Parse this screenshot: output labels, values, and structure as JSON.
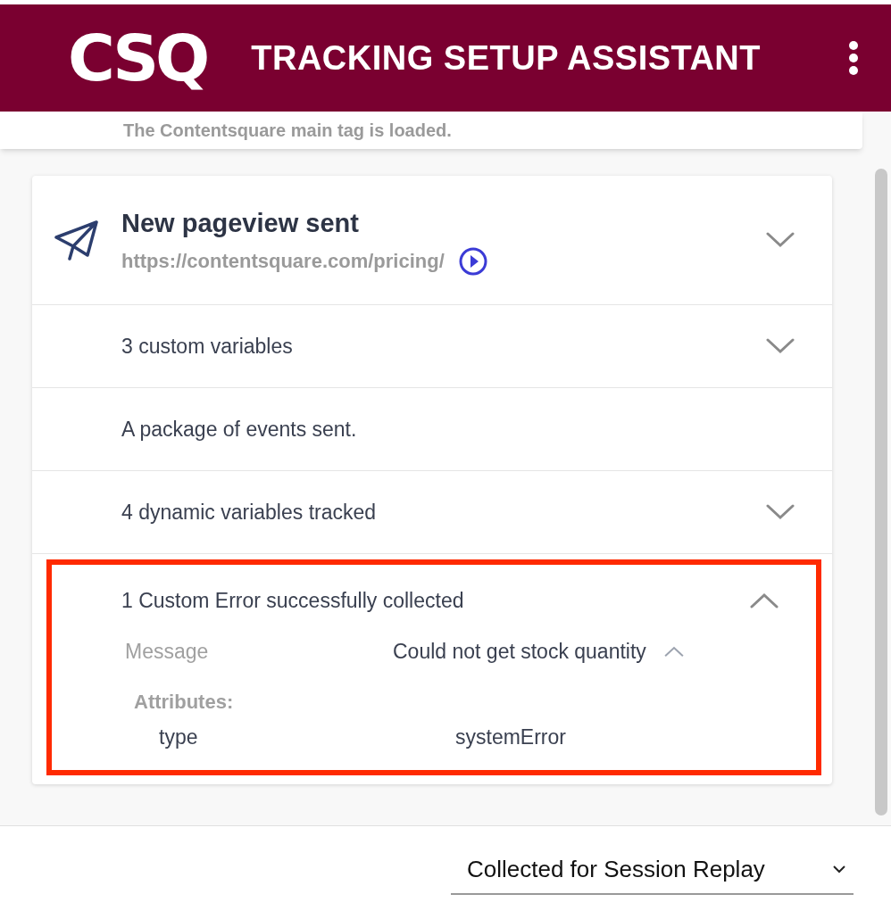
{
  "header": {
    "logo": "CSQ",
    "title": "TRACKING SETUP ASSISTANT"
  },
  "status_card": {
    "text": "The Contentsquare main tag is loaded."
  },
  "event_card": {
    "title": "New pageview sent",
    "url": "https://contentsquare.com/pricing/",
    "expanded": false,
    "rows": [
      {
        "kind": "expandable",
        "label": "3 custom variables",
        "expanded": false,
        "highlighted": false
      },
      {
        "kind": "plain",
        "label": "A package of events sent.",
        "highlighted": false
      },
      {
        "kind": "expandable",
        "label": "4 dynamic variables tracked",
        "expanded": false,
        "highlighted": false
      },
      {
        "kind": "expandable",
        "label": "1 Custom Error successfully collected",
        "expanded": true,
        "highlighted": true,
        "details": {
          "message_label": "Message",
          "message_value": "Could not get stock quantity",
          "message_expanded": true,
          "attributes_heading": "Attributes:",
          "attributes": [
            {
              "name": "type",
              "value": "systemError"
            }
          ]
        }
      }
    ]
  },
  "footer": {
    "select_value": "Collected for Session Replay"
  }
}
